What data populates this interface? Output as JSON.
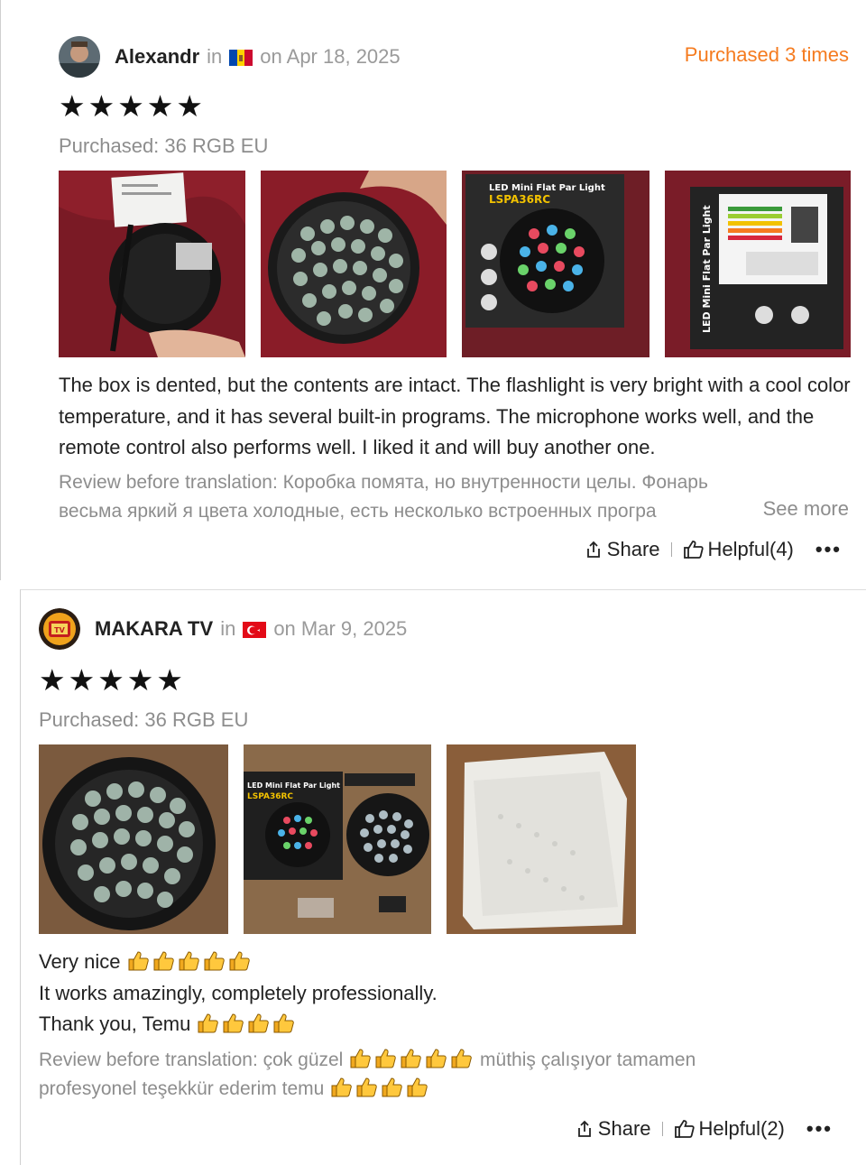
{
  "reviews": [
    {
      "username": "Alexandr",
      "in_text": "in",
      "country_flag": "moldova-flag",
      "date": "on Apr 18, 2025",
      "purchased_times": "Purchased 3 times",
      "stars": 5,
      "purchased_variant": "Purchased: 36 RGB EU",
      "photos": [
        "photo-1",
        "photo-2",
        "photo-3",
        "photo-4"
      ],
      "review_text": "The box is dented, but the contents are intact. The flashlight is very bright with a cool color temperature, and it has several built-in programs. The microphone works well, and the remote control also performs well. I liked it and will buy another one.",
      "original_line1": "Review before translation: Коробка помята, но внутренности целы. Фонарь",
      "original_line2": "весьма яркий я цвета холодные, есть несколько встроенных програ",
      "see_more": "See more",
      "share": "Share",
      "helpful": "Helpful(4)"
    },
    {
      "username": "MAKARA TV",
      "in_text": "in",
      "country_flag": "turkey-flag",
      "date": "on Mar 9, 2025",
      "stars": 5,
      "purchased_variant": "Purchased: 36 RGB EU",
      "photos": [
        "photo-1",
        "photo-2",
        "photo-3"
      ],
      "review_line1": "Very nice",
      "review_line2": "It works amazingly, completely professionally.",
      "review_line3": "Thank you, Temu",
      "original_line1a": "Review before translation: çok güzel",
      "original_line1b": "müthiş çalışıyor tamamen",
      "original_line2": "profesyonel teşekkür ederim temu",
      "share": "Share",
      "helpful": "Helpful(2)"
    }
  ],
  "colors": {
    "accent_orange": "#f57b1f",
    "muted_gray": "#8d8d8d"
  },
  "icons": {
    "share": "share-icon",
    "helpful": "thumbs-up-icon",
    "more": "more-icon",
    "emoji": "thumbs-up-emoji"
  }
}
